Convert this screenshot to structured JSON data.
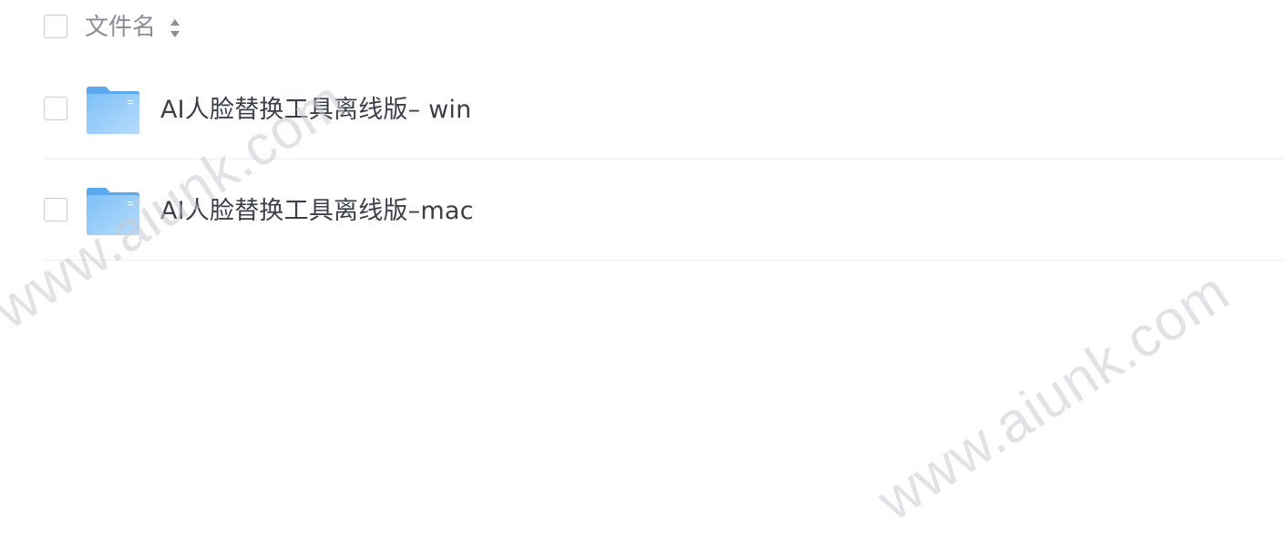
{
  "header": {
    "column_label": "文件名",
    "sort_icon": "sort-arrows-icon"
  },
  "files": [
    {
      "name": "AI人脸替换工具离线版– win",
      "icon": "folder-icon"
    },
    {
      "name": "AI人脸替换工具离线版–mac",
      "icon": "folder-icon"
    }
  ],
  "watermark": {
    "text": "www.aiunk.com"
  },
  "colors": {
    "folder_light": "#a9d6fb",
    "folder_dark": "#5aa8ee",
    "checkbox_border": "#c9ccd3",
    "divider": "#eef0f3",
    "text": "#3b3f4a",
    "header_text": "#8a8e97"
  }
}
